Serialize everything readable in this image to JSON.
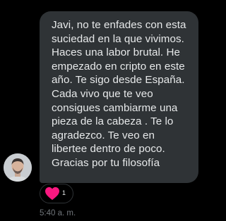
{
  "message": {
    "text": "Javi, no te enfades con esta suciedad en la que vivimos. Haces una labor brutal. He empezado en cripto en este año. Te sigo desde España. Cada vivo que te veo consigues cambiarme una pieza de la cabeza . Te lo agradezco.  Te veo en libertee dentro de poco. Gracias por tu filosofía",
    "timestamp": "5:40 a. m."
  },
  "reaction": {
    "icon": "heart-icon",
    "count": "1",
    "color": "#f91880"
  },
  "colors": {
    "background": "#000000",
    "bubble": "#2f3336",
    "text": "#e7e9ea",
    "muted": "#71767b"
  }
}
